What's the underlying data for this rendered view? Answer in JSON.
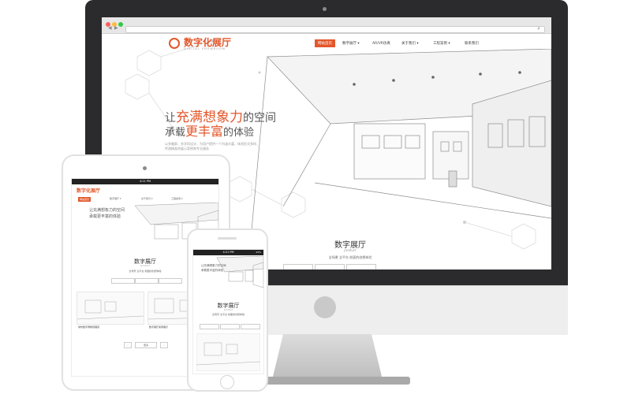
{
  "colors": {
    "accent": "#e2572b",
    "frame": "#2b2b2d",
    "device_body": "#eeeeee"
  },
  "desktop": {
    "logo": {
      "text": "数字化展厅",
      "subtitle": "DIGITAL SHOWROOM",
      "icon": "logo-mark-icon"
    },
    "nav": [
      "网站首页",
      "数字展厅 ▾",
      "AR/VR仿真",
      "关于我们 ▾",
      "工程案例 ▾",
      "联系我们"
    ],
    "hero": {
      "line1_prefix": "让",
      "line1_accent": "充满想象力",
      "line1_suffix": "的空间",
      "line2_prefix": "承载",
      "line2_accent": "更丰富",
      "line2_suffix": "的体验",
      "desc": "以多集群、多学科设计，为用户提供一个内涵丰富、体验形式多样、传递精准的展示案例和专业服务"
    },
    "section": {
      "title": "数字展厅",
      "subtitle": "product",
      "desc": "全场景 全平台 前面的创想体验"
    }
  },
  "tablet": {
    "status": "4:21 PM",
    "logo": "数字化展厅",
    "nav": [
      "网站首页",
      "数字展厅 ▾",
      "关于我们 ▾",
      "工程案例 ▾"
    ],
    "hero": {
      "line1": "让充满想象力的空间",
      "line2": "承载更丰富的体验"
    },
    "section": {
      "title": "数字展厅",
      "subtitle": "product",
      "desc": "全场景 全平台 前面的创想体验"
    },
    "captions": [
      "城市数字博物馆展馆",
      "数字展厅案例展示"
    ],
    "pagination": [
      "‹",
      "更多",
      "›"
    ]
  },
  "phone": {
    "status": "4:21 PM",
    "battery": "22%",
    "hero": {
      "line1": "让充满想象力的空间",
      "line2": "承载更丰富的体验"
    },
    "section": {
      "title": "数字展厅",
      "subtitle": "product",
      "desc": "全场景 全平台 前面的创想体验"
    }
  }
}
